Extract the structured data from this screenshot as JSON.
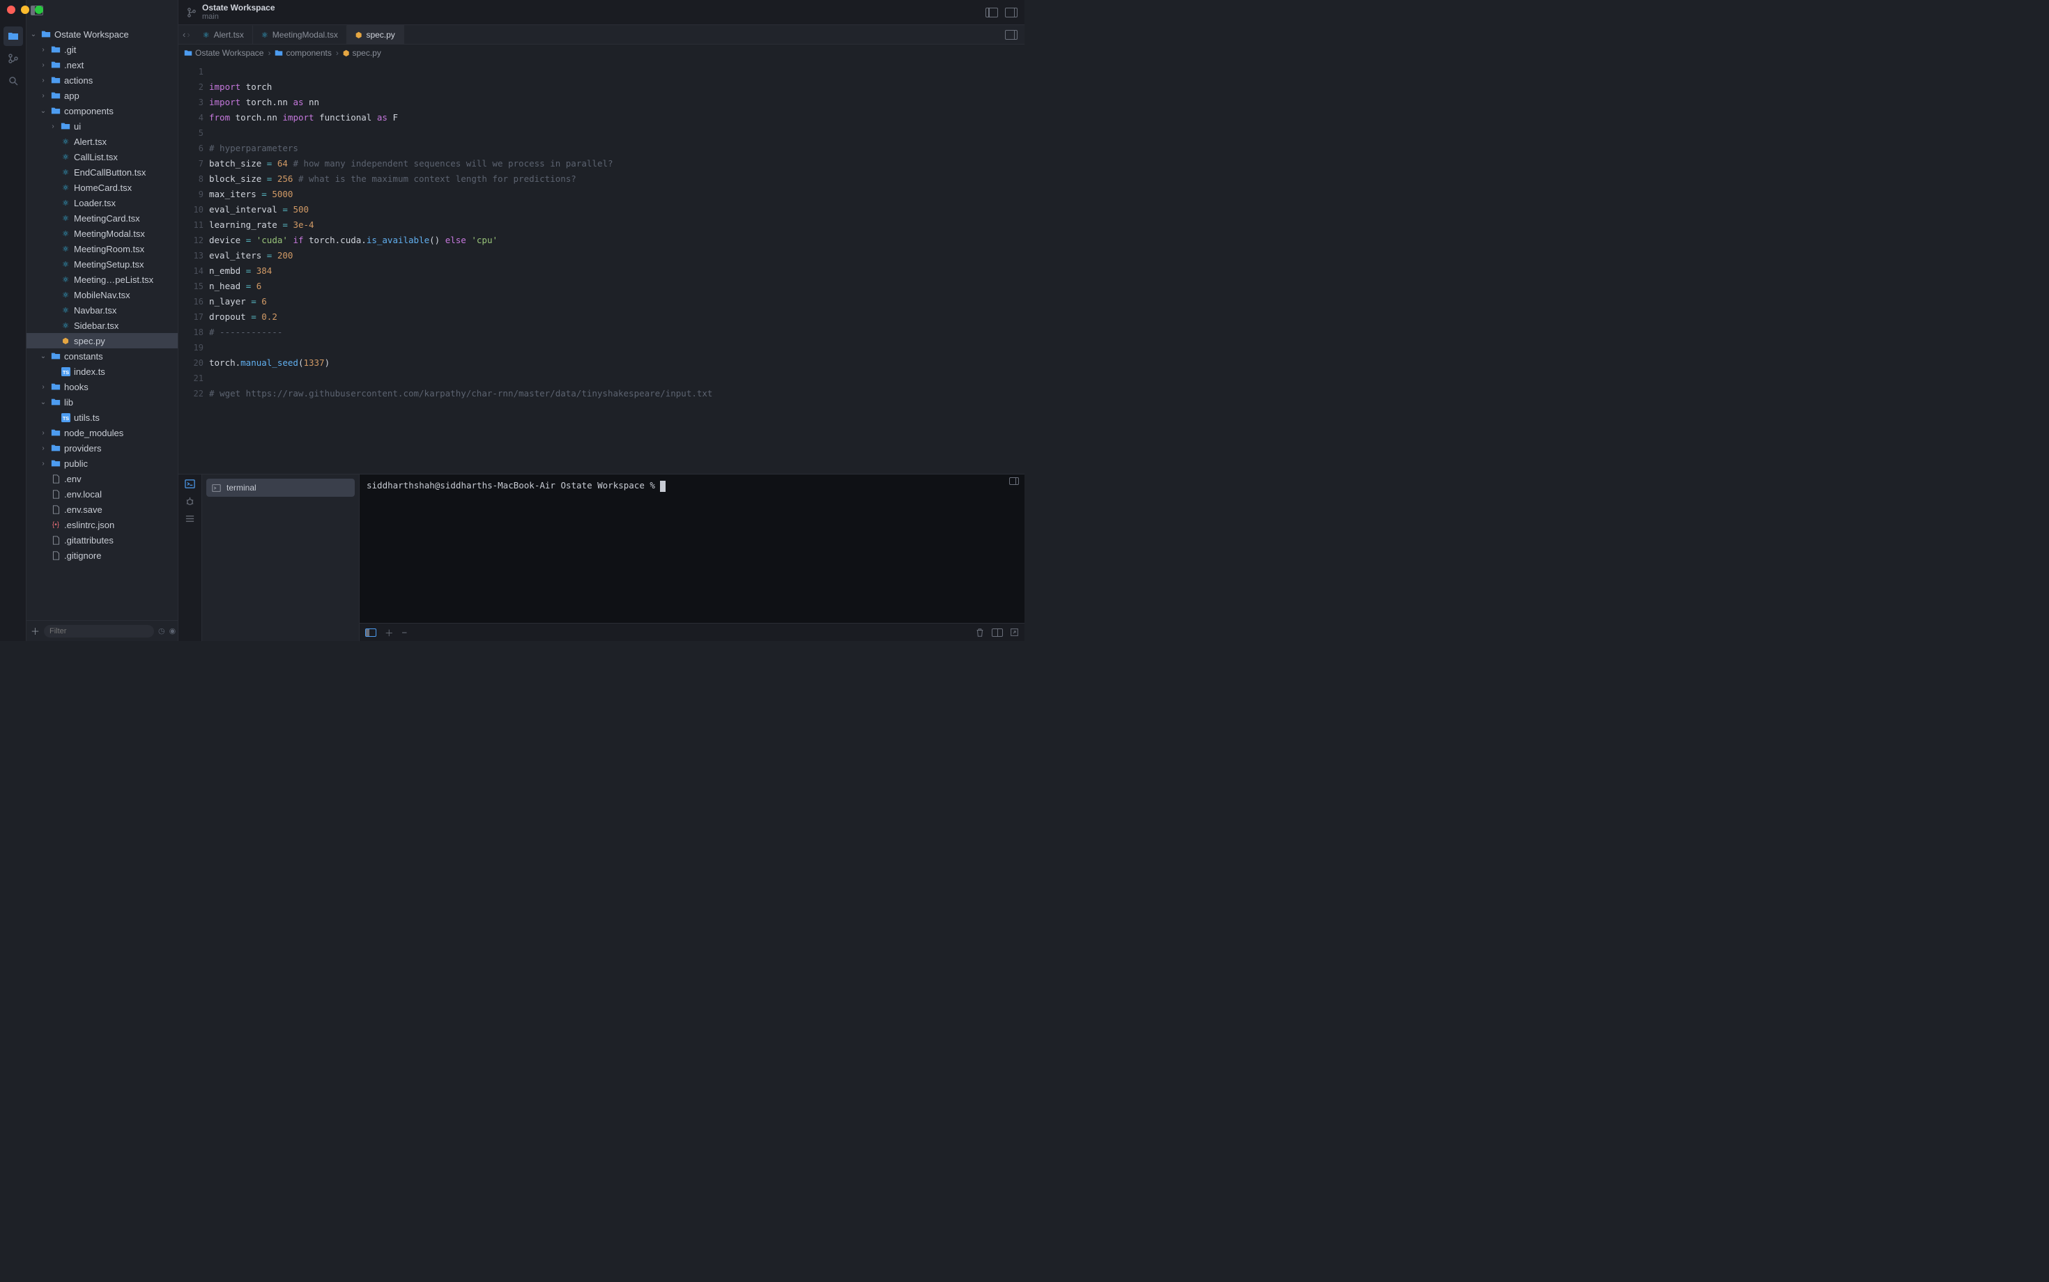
{
  "window": {
    "title": "Ostate Workspace",
    "branch": "main"
  },
  "activity": {
    "items": [
      "folder-icon",
      "git-icon",
      "search-icon"
    ]
  },
  "tree": {
    "root": "Ostate Workspace",
    "nodes": [
      {
        "depth": 0,
        "chev": "v",
        "type": "folder",
        "label": "Ostate Workspace",
        "sel": false
      },
      {
        "depth": 1,
        "chev": ">",
        "type": "folder",
        "label": ".git",
        "sel": false
      },
      {
        "depth": 1,
        "chev": ">",
        "type": "folder",
        "label": ".next",
        "sel": false
      },
      {
        "depth": 1,
        "chev": ">",
        "type": "folder",
        "label": "actions",
        "sel": false
      },
      {
        "depth": 1,
        "chev": ">",
        "type": "folder",
        "label": "app",
        "sel": false
      },
      {
        "depth": 1,
        "chev": "v",
        "type": "folder",
        "label": "components",
        "sel": false
      },
      {
        "depth": 2,
        "chev": ">",
        "type": "folder",
        "label": "ui",
        "sel": false
      },
      {
        "depth": 2,
        "chev": "",
        "type": "react",
        "label": "Alert.tsx",
        "sel": false
      },
      {
        "depth": 2,
        "chev": "",
        "type": "react",
        "label": "CallList.tsx",
        "sel": false
      },
      {
        "depth": 2,
        "chev": "",
        "type": "react",
        "label": "EndCallButton.tsx",
        "sel": false
      },
      {
        "depth": 2,
        "chev": "",
        "type": "react",
        "label": "HomeCard.tsx",
        "sel": false
      },
      {
        "depth": 2,
        "chev": "",
        "type": "react",
        "label": "Loader.tsx",
        "sel": false
      },
      {
        "depth": 2,
        "chev": "",
        "type": "react",
        "label": "MeetingCard.tsx",
        "sel": false
      },
      {
        "depth": 2,
        "chev": "",
        "type": "react",
        "label": "MeetingModal.tsx",
        "sel": false
      },
      {
        "depth": 2,
        "chev": "",
        "type": "react",
        "label": "MeetingRoom.tsx",
        "sel": false
      },
      {
        "depth": 2,
        "chev": "",
        "type": "react",
        "label": "MeetingSetup.tsx",
        "sel": false
      },
      {
        "depth": 2,
        "chev": "",
        "type": "react",
        "label": "Meeting…peList.tsx",
        "sel": false
      },
      {
        "depth": 2,
        "chev": "",
        "type": "react",
        "label": "MobileNav.tsx",
        "sel": false
      },
      {
        "depth": 2,
        "chev": "",
        "type": "react",
        "label": "Navbar.tsx",
        "sel": false
      },
      {
        "depth": 2,
        "chev": "",
        "type": "react",
        "label": "Sidebar.tsx",
        "sel": false
      },
      {
        "depth": 2,
        "chev": "",
        "type": "python",
        "label": "spec.py",
        "sel": true
      },
      {
        "depth": 1,
        "chev": "v",
        "type": "folder",
        "label": "constants",
        "sel": false
      },
      {
        "depth": 2,
        "chev": "",
        "type": "ts",
        "label": "index.ts",
        "sel": false
      },
      {
        "depth": 1,
        "chev": ">",
        "type": "folder",
        "label": "hooks",
        "sel": false
      },
      {
        "depth": 1,
        "chev": "v",
        "type": "folder",
        "label": "lib",
        "sel": false
      },
      {
        "depth": 2,
        "chev": "",
        "type": "ts",
        "label": "utils.ts",
        "sel": false
      },
      {
        "depth": 1,
        "chev": ">",
        "type": "folder",
        "label": "node_modules",
        "sel": false
      },
      {
        "depth": 1,
        "chev": ">",
        "type": "folder",
        "label": "providers",
        "sel": false
      },
      {
        "depth": 1,
        "chev": ">",
        "type": "folder",
        "label": "public",
        "sel": false
      },
      {
        "depth": 1,
        "chev": "",
        "type": "file",
        "label": ".env",
        "sel": false
      },
      {
        "depth": 1,
        "chev": "",
        "type": "file",
        "label": ".env.local",
        "sel": false
      },
      {
        "depth": 1,
        "chev": "",
        "type": "file",
        "label": ".env.save",
        "sel": false
      },
      {
        "depth": 1,
        "chev": "",
        "type": "json",
        "label": ".eslintrc.json",
        "sel": false
      },
      {
        "depth": 1,
        "chev": "",
        "type": "file",
        "label": ".gitattributes",
        "sel": false
      },
      {
        "depth": 1,
        "chev": "",
        "type": "file",
        "label": ".gitignore",
        "sel": false
      }
    ]
  },
  "filter": {
    "placeholder": "Filter"
  },
  "tabs": [
    {
      "icon": "react",
      "label": "Alert.tsx",
      "active": false
    },
    {
      "icon": "react",
      "label": "MeetingModal.tsx",
      "active": false
    },
    {
      "icon": "python",
      "label": "spec.py",
      "active": true
    }
  ],
  "breadcrumb": [
    {
      "icon": "folder",
      "label": "Ostate Workspace"
    },
    {
      "icon": "folder",
      "label": "components"
    },
    {
      "icon": "python",
      "label": "spec.py"
    }
  ],
  "code": {
    "lines": [
      {
        "n": 1,
        "html": ""
      },
      {
        "n": 2,
        "html": "<span class='k-import'>import</span> <span class='mod'>torch</span>"
      },
      {
        "n": 3,
        "html": "<span class='k-import'>import</span> <span class='mod'>torch.nn</span> <span class='k-as'>as</span> <span class='mod'>nn</span>"
      },
      {
        "n": 4,
        "html": "<span class='k-from'>from</span> <span class='mod'>torch.nn</span> <span class='k-import'>import</span> <span class='mod'>functional</span> <span class='k-as'>as</span> <span class='mod'>F</span>"
      },
      {
        "n": 5,
        "html": ""
      },
      {
        "n": 6,
        "html": "<span class='cmt'># hyperparameters</span>"
      },
      {
        "n": 7,
        "html": "<span class='ident'>batch_size</span> <span class='op'>=</span> <span class='num'>64</span> <span class='cmt'># how many independent sequences will we process in parallel?</span>"
      },
      {
        "n": 8,
        "html": "<span class='ident'>block_size</span> <span class='op'>=</span> <span class='num'>256</span> <span class='cmt'># what is the maximum context length for predictions?</span>"
      },
      {
        "n": 9,
        "html": "<span class='ident'>max_iters</span> <span class='op'>=</span> <span class='num'>5000</span>"
      },
      {
        "n": 10,
        "html": "<span class='ident'>eval_interval</span> <span class='op'>=</span> <span class='num'>500</span>"
      },
      {
        "n": 11,
        "html": "<span class='ident'>learning_rate</span> <span class='op'>=</span> <span class='num'>3e-4</span>"
      },
      {
        "n": 12,
        "html": "<span class='ident'>device</span> <span class='op'>=</span> <span class='str'>'cuda'</span> <span class='k-if'>if</span> <span class='ident'>torch.cuda.</span><span class='fn'>is_available</span><span class='ident'>()</span> <span class='k-else'>else</span> <span class='str'>'cpu'</span>"
      },
      {
        "n": 13,
        "html": "<span class='ident'>eval_iters</span> <span class='op'>=</span> <span class='num'>200</span>"
      },
      {
        "n": 14,
        "html": "<span class='ident'>n_embd</span> <span class='op'>=</span> <span class='num'>384</span>"
      },
      {
        "n": 15,
        "html": "<span class='ident'>n_head</span> <span class='op'>=</span> <span class='num'>6</span>"
      },
      {
        "n": 16,
        "html": "<span class='ident'>n_layer</span> <span class='op'>=</span> <span class='num'>6</span>"
      },
      {
        "n": 17,
        "html": "<span class='ident'>dropout</span> <span class='op'>=</span> <span class='num'>0.2</span>"
      },
      {
        "n": 18,
        "html": "<span class='cmt'># ------------</span>"
      },
      {
        "n": 19,
        "html": ""
      },
      {
        "n": 20,
        "html": "<span class='ident'>torch.</span><span class='fn'>manual_seed</span><span class='ident'>(</span><span class='num'>1337</span><span class='ident'>)</span>"
      },
      {
        "n": 21,
        "html": ""
      },
      {
        "n": 22,
        "html": "<span class='cmt'># wget https://raw.githubusercontent.com/karpathy/char-rnn/master/data/tinyshakespeare/input.txt</span>"
      }
    ]
  },
  "terminal": {
    "tab_label": "terminal",
    "prompt": "siddharthshah@siddharths-MacBook-Air Ostate Workspace % "
  }
}
